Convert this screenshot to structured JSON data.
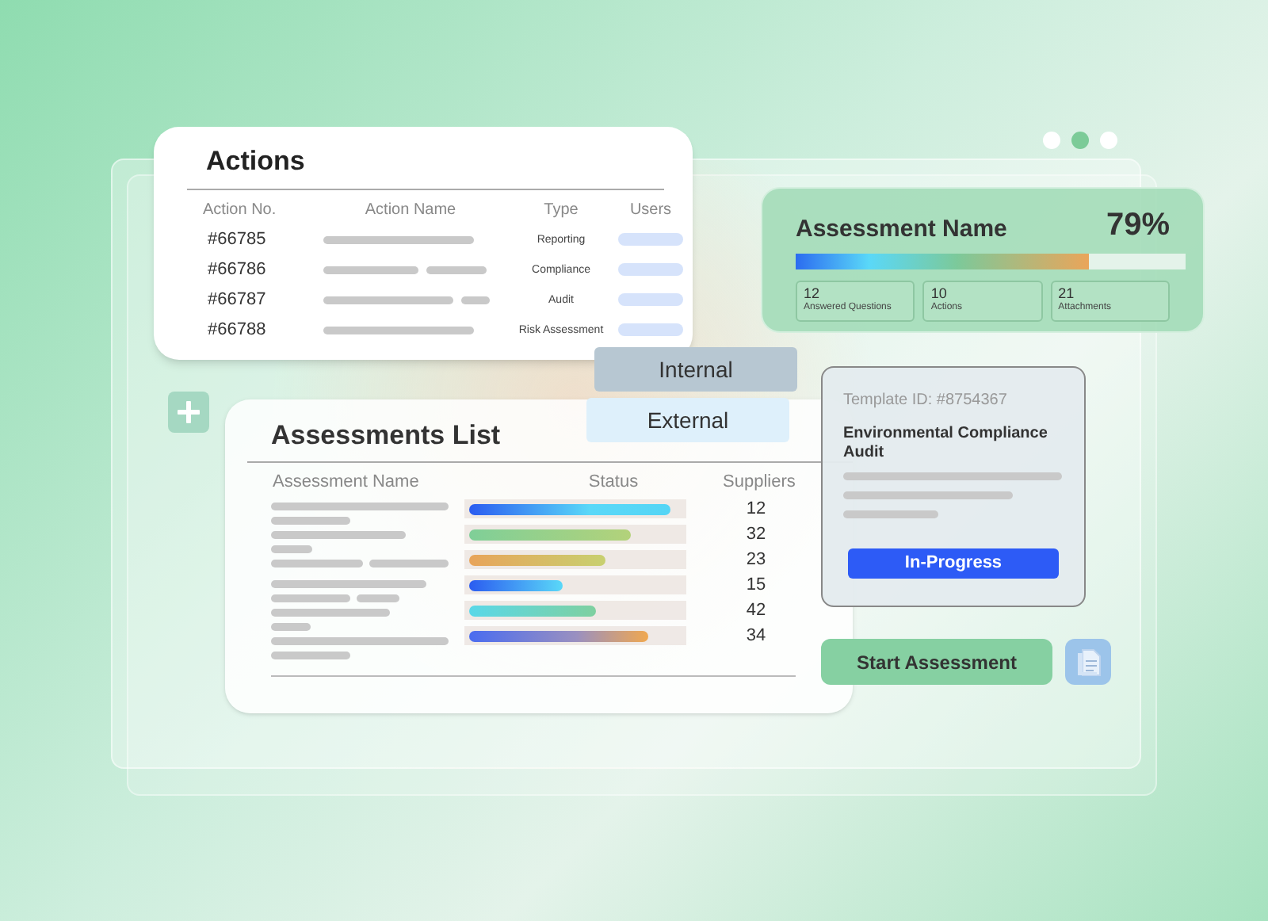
{
  "window_dots": [
    {
      "selected": false
    },
    {
      "selected": true
    },
    {
      "selected": false
    }
  ],
  "actions": {
    "title": "Actions",
    "columns": [
      "Action No.",
      "Action Name",
      "Type",
      "Users"
    ],
    "rows": [
      {
        "number": "#66785",
        "type": "Reporting"
      },
      {
        "number": "#66786",
        "type": "Compliance"
      },
      {
        "number": "#66787",
        "type": "Audit"
      },
      {
        "number": "#66788",
        "type": "Risk Assessment"
      }
    ]
  },
  "assessment": {
    "title": "Assessment Name",
    "percent": "79%",
    "level": 0.79,
    "stats": [
      {
        "value": "12",
        "label": "Answered Questions"
      },
      {
        "value": "10",
        "label": "Actions"
      },
      {
        "value": "21",
        "label": "Attachments"
      }
    ]
  },
  "tabs": [
    {
      "label": "Internal",
      "selected": true
    },
    {
      "label": "External",
      "selected": false
    }
  ],
  "assessments_list": {
    "title": "Assessments List",
    "columns": [
      "Assessment Name",
      "Status",
      "Suppliers"
    ],
    "rows": [
      {
        "level": 0.95,
        "suppliers": "12"
      },
      {
        "level": 0.76,
        "suppliers": "32"
      },
      {
        "level": 0.64,
        "suppliers": "23"
      },
      {
        "level": 0.44,
        "suppliers": "15"
      },
      {
        "level": 0.6,
        "suppliers": "42"
      },
      {
        "level": 0.84,
        "suppliers": "34"
      }
    ]
  },
  "template": {
    "template_id": "Template ID: #8754367",
    "title": "Environmental Compliance Audit",
    "status": "In-Progress"
  },
  "start_button": {
    "label": "Start Assessment"
  }
}
